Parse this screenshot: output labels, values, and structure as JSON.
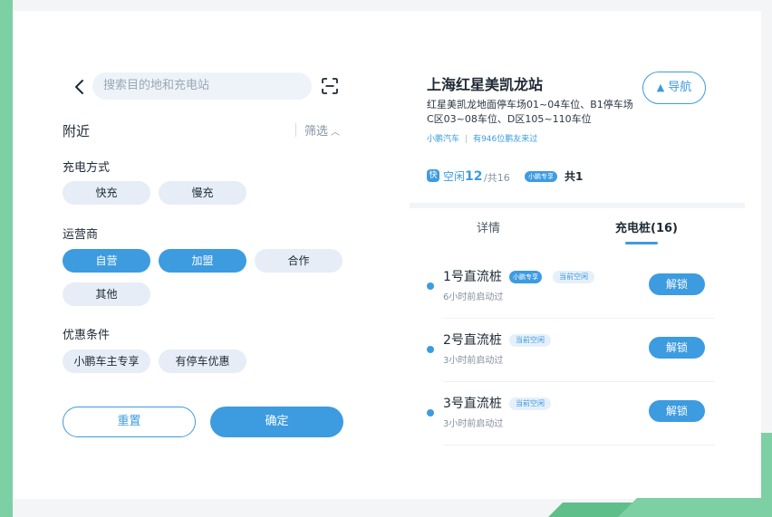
{
  "colors": {
    "accent": "#3d9be0",
    "chip_bg": "#e6edf6",
    "frame_green": "#7dd0a3"
  },
  "search": {
    "back_icon": "chevron-left-icon",
    "placeholder": "搜索目的地和充电站",
    "scan_icon": "scan-icon"
  },
  "filter": {
    "nearby_label": "附近",
    "filter_label": "筛选",
    "filter_icon": "chevron-up-icon",
    "charge_mode": {
      "title": "充电方式",
      "options": [
        "快充",
        "慢充"
      ]
    },
    "operator": {
      "title": "运营商",
      "options": [
        "自营",
        "加盟",
        "合作",
        "其他"
      ]
    },
    "discount": {
      "title": "优惠条件",
      "options": [
        "小鹏车主专享",
        "有停车优惠"
      ]
    },
    "reset_label": "重置",
    "confirm_label": "确定"
  },
  "station": {
    "name": "上海红星美凯龙站",
    "nav_label": "导航",
    "nav_icon": "navigation-arrow-icon",
    "address": "红星美凯龙地面停车场01~04车位、B1停车场C区03~08车位、D区105~110车位",
    "operator": "小鹏汽车",
    "visitors": "有946位鹏友来过",
    "fast_badge": "快",
    "idle_label": "空闲",
    "idle_count": "12",
    "total": "/共16",
    "exclusive_label": "小鹏专享",
    "exclusive_count": "共1"
  },
  "tabs": [
    {
      "label": "详情",
      "active": false
    },
    {
      "label": "充电桩(16)",
      "active": true
    }
  ],
  "piles": [
    {
      "name": "1号直流桩",
      "exclusive": "小鹏专享",
      "status": "当前空闲",
      "time": "6小时前启动过",
      "action": "解锁"
    },
    {
      "name": "2号直流桩",
      "exclusive": "",
      "status": "当前空闲",
      "time": "3小时前启动过",
      "action": "解锁"
    },
    {
      "name": "3号直流桩",
      "exclusive": "",
      "status": "当前空闲",
      "time": "3小时前启动过",
      "action": "解锁"
    }
  ]
}
